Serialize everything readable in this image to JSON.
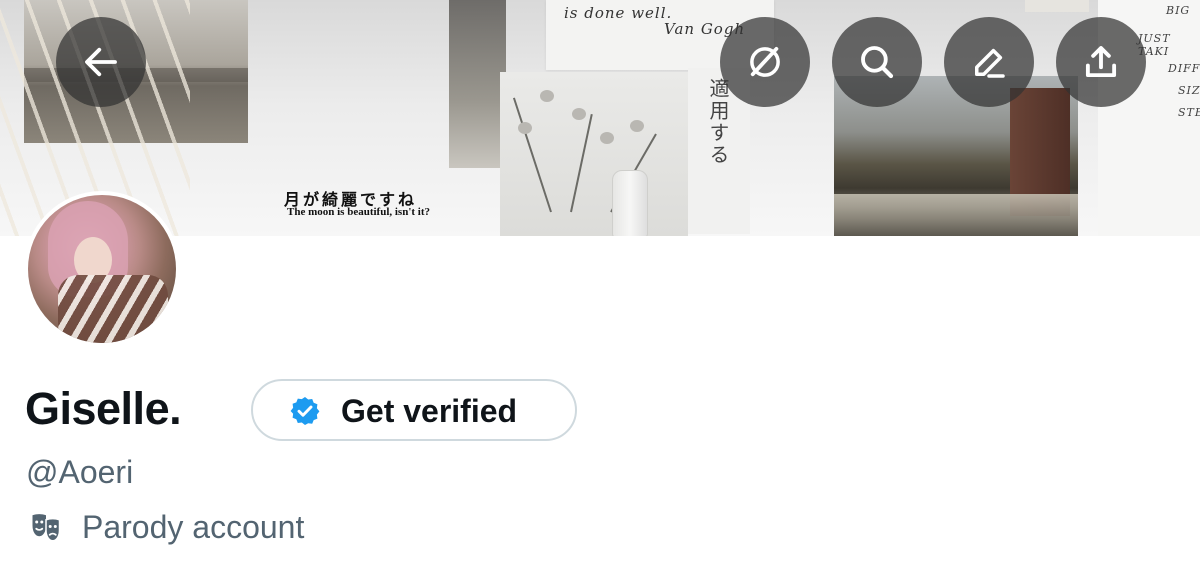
{
  "banner": {
    "jp_caption": "月が綺麗ですね",
    "en_caption": "The moon is beautiful, isn't it?",
    "note_top_line1": "is done well.",
    "note_top_line2": "Van Gogh",
    "jp_vertical": "適用する",
    "right_note_lines": [
      "BIG",
      "JUST TAKI",
      "DIFF",
      "SIZ",
      "STE"
    ]
  },
  "actions": {
    "back": "back-arrow-icon",
    "grok": "grok-icon",
    "search": "search-icon",
    "edit": "edit-icon",
    "share": "share-icon",
    "button_bg": "#323232"
  },
  "profile": {
    "name": "Giselle.",
    "verify_label": "Get verified",
    "verify_badge_color": "#1d9bf0",
    "handle": "@Aoeri",
    "account_label": "Parody account",
    "account_icon": "theater-masks-icon",
    "secondary_text_color": "#536471"
  }
}
